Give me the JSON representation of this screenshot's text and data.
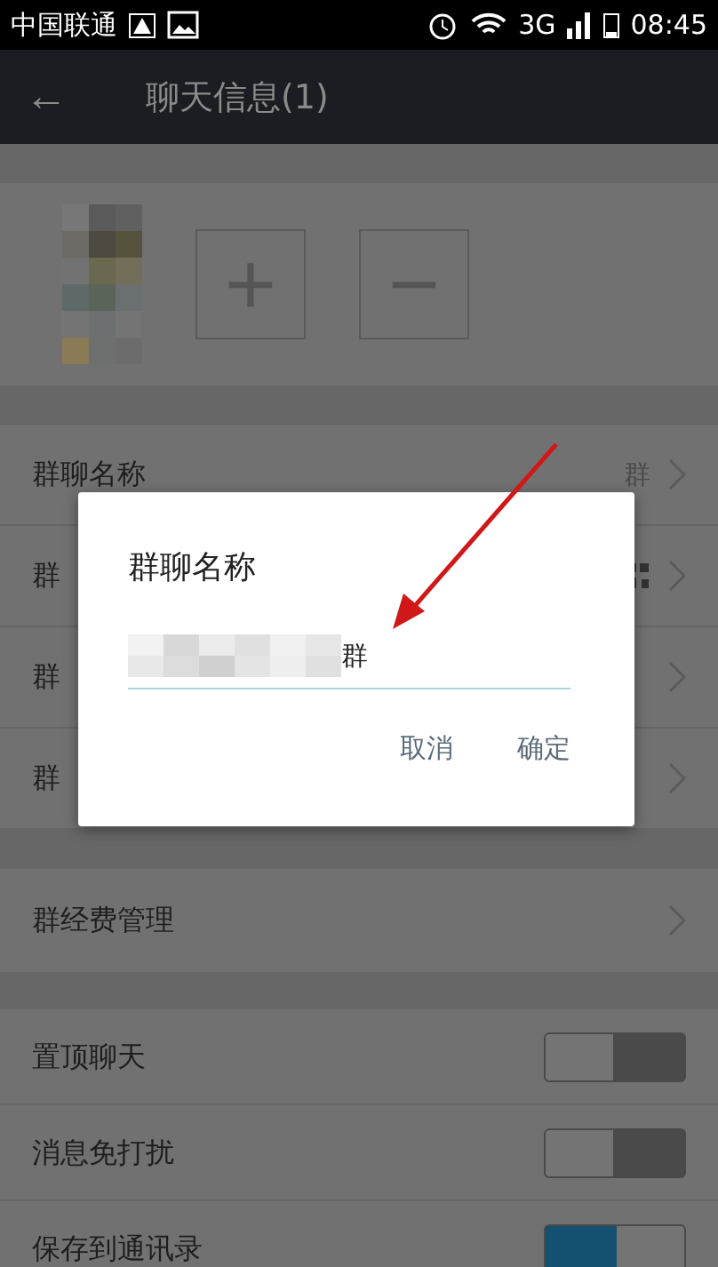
{
  "status_bar": {
    "carrier": "中国联通",
    "network": "3G",
    "time": "08:45"
  },
  "header": {
    "back": "←",
    "title": "聊天信息(1)"
  },
  "members": {
    "add": "+",
    "remove": "−"
  },
  "rows": [
    {
      "label": "群聊名称",
      "value": "群"
    },
    {
      "label": "群",
      "qr": true
    },
    {
      "label": "群"
    },
    {
      "label": "群"
    }
  ],
  "fund_row": {
    "label": "群经费管理"
  },
  "toggles": [
    {
      "label": "置顶聊天",
      "on": false
    },
    {
      "label": "消息免打扰",
      "on": false
    },
    {
      "label": "保存到通讯录",
      "on": true
    }
  ],
  "dialog": {
    "title": "群聊名称",
    "value": "群",
    "buttons": [
      "取消",
      "确定"
    ]
  }
}
